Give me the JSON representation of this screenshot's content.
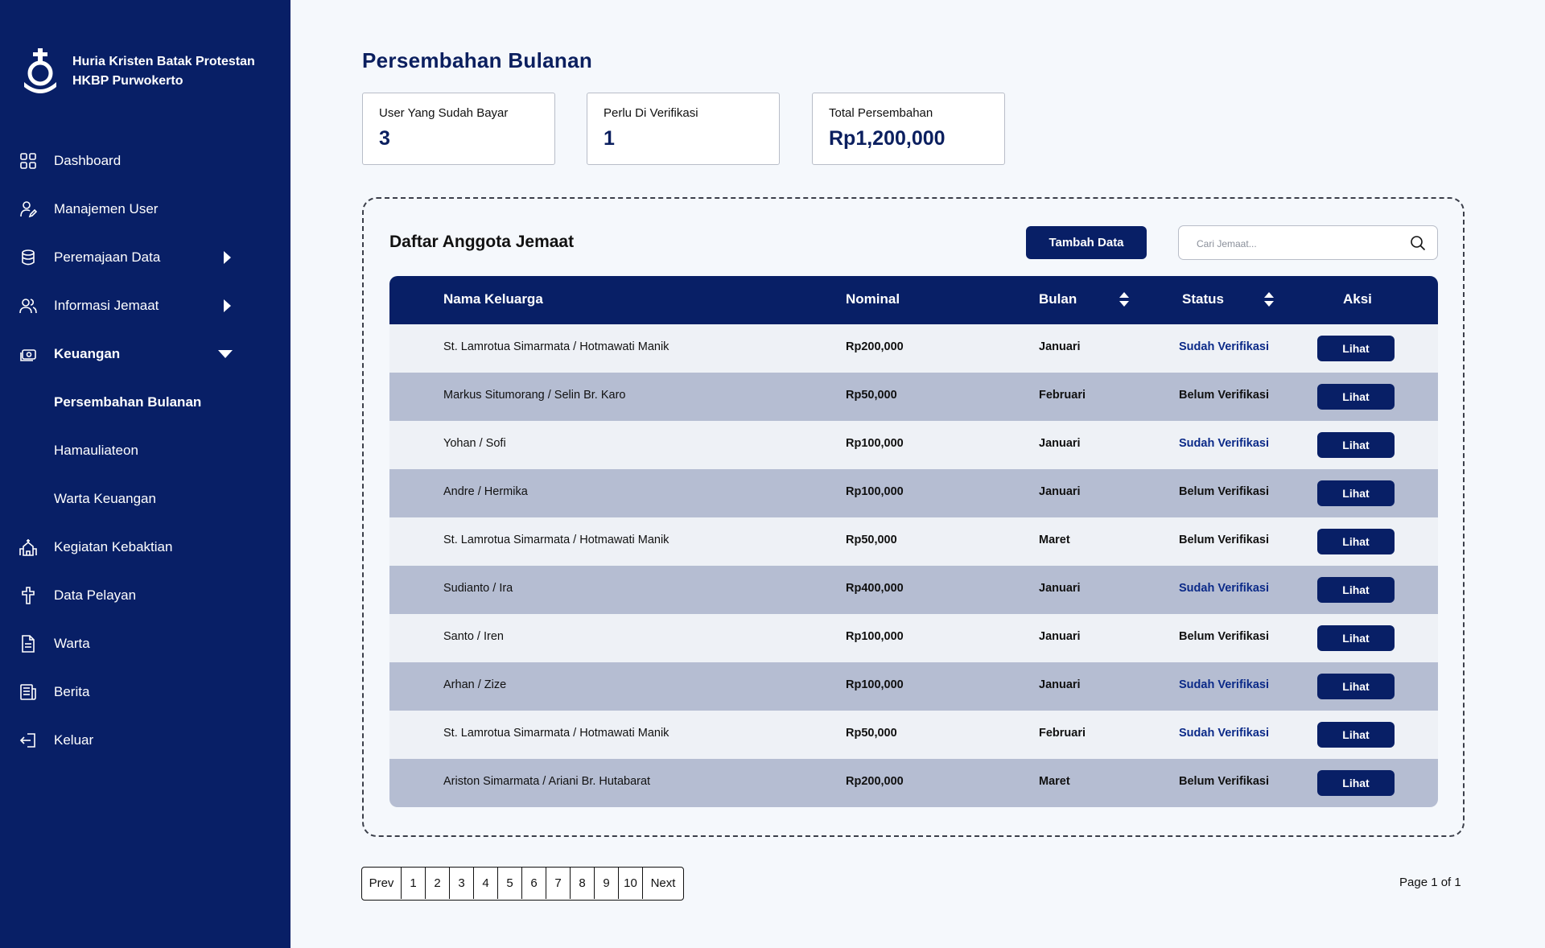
{
  "brand": {
    "line1": "Huria Kristen Batak Protestan",
    "line2": "HKBP Purwokerto",
    "logo_text": "HKBP"
  },
  "sidebar": {
    "items": [
      {
        "label": "Dashboard",
        "icon": "grid-icon"
      },
      {
        "label": "Manajemen User",
        "icon": "user-edit-icon"
      },
      {
        "label": "Peremajaan Data",
        "icon": "database-icon",
        "caret": "right"
      },
      {
        "label": "Informasi Jemaat",
        "icon": "users-icon",
        "caret": "right"
      },
      {
        "label": "Keuangan",
        "icon": "money-icon",
        "caret": "down",
        "active": true
      },
      {
        "label": "Persembahan Bulanan",
        "sub": true,
        "active": true
      },
      {
        "label": "Hamauliateon",
        "sub": true
      },
      {
        "label": "Warta Keuangan",
        "sub": true
      },
      {
        "label": "Kegiatan Kebaktian",
        "icon": "church-icon"
      },
      {
        "label": "Data Pelayan",
        "icon": "cross-icon"
      },
      {
        "label": "Warta",
        "icon": "document-icon"
      },
      {
        "label": "Berita",
        "icon": "newspaper-icon"
      },
      {
        "label": "Keluar",
        "icon": "logout-icon"
      }
    ]
  },
  "page": {
    "title": "Persembahan Bulanan"
  },
  "stats": [
    {
      "label": "User Yang Sudah Bayar",
      "value": "3"
    },
    {
      "label": "Perlu Di Verifikasi",
      "value": "1"
    },
    {
      "label": "Total Persembahan",
      "value": "Rp1,200,000"
    }
  ],
  "panel": {
    "title": "Daftar Anggota Jemaat",
    "add_button": "Tambah Data",
    "search_placeholder": "Cari Jemaat..."
  },
  "table": {
    "headers": {
      "nama": "Nama Keluarga",
      "nominal": "Nominal",
      "bulan": "Bulan",
      "status": "Status",
      "aksi": "Aksi"
    },
    "rows": [
      {
        "nama": "St. Lamrotua Simarmata / Hotmawati Manik",
        "nominal": "Rp200,000",
        "bulan": "Januari",
        "status": "Sudah Verifikasi",
        "aksi": "Lihat"
      },
      {
        "nama": "Markus Situmorang / Selin Br. Karo",
        "nominal": "Rp50,000",
        "bulan": "Februari",
        "status": "Belum Verifikasi",
        "aksi": "Lihat"
      },
      {
        "nama": "Yohan / Sofi",
        "nominal": "Rp100,000",
        "bulan": "Januari",
        "status": "Sudah Verifikasi",
        "aksi": "Lihat"
      },
      {
        "nama": "Andre / Hermika",
        "nominal": "Rp100,000",
        "bulan": "Januari",
        "status": "Belum Verifikasi",
        "aksi": "Lihat"
      },
      {
        "nama": "St. Lamrotua Simarmata / Hotmawati Manik",
        "nominal": "Rp50,000",
        "bulan": "Maret",
        "status": "Belum Verifikasi",
        "aksi": "Lihat"
      },
      {
        "nama": "Sudianto / Ira",
        "nominal": "Rp400,000",
        "bulan": "Januari",
        "status": "Sudah Verifikasi",
        "aksi": "Lihat"
      },
      {
        "nama": "Santo / Iren",
        "nominal": "Rp100,000",
        "bulan": "Januari",
        "status": "Belum Verifikasi",
        "aksi": "Lihat"
      },
      {
        "nama": "Arhan / Zize",
        "nominal": "Rp100,000",
        "bulan": "Januari",
        "status": "Sudah Verifikasi",
        "aksi": "Lihat"
      },
      {
        "nama": "St. Lamrotua Simarmata / Hotmawati Manik",
        "nominal": "Rp50,000",
        "bulan": "Februari",
        "status": "Sudah Verifikasi",
        "aksi": "Lihat"
      },
      {
        "nama": "Ariston Simarmata / Ariani Br. Hutabarat",
        "nominal": "Rp200,000",
        "bulan": "Maret",
        "status": "Belum Verifikasi",
        "aksi": "Lihat"
      }
    ]
  },
  "pagination": {
    "prev": "Prev",
    "pages": [
      "1",
      "2",
      "3",
      "4",
      "5",
      "6",
      "7",
      "8",
      "9",
      "10"
    ],
    "next": "Next",
    "info": "Page 1 of 1"
  },
  "colors": {
    "primary": "#081f66",
    "row_alt": "#b5bdd2",
    "row_light": "#eef1f6",
    "verified": "#0b2a88"
  }
}
